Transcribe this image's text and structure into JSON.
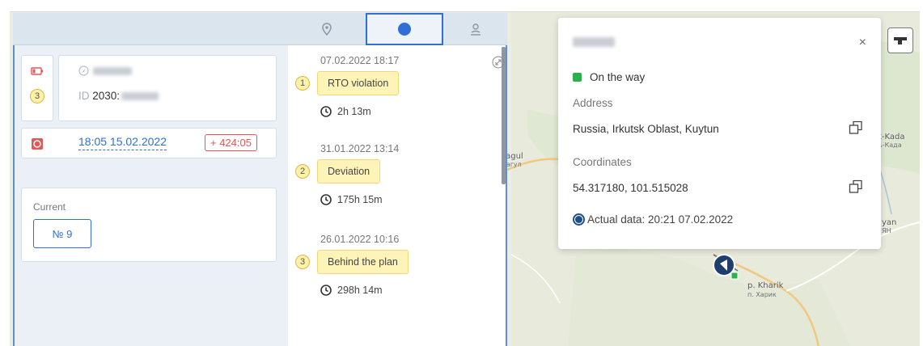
{
  "vehicle": {
    "badge_number": "3",
    "id_prefix": "ID",
    "id_value": "2030:"
  },
  "status_card": {
    "time": "18:05 15.02.2022",
    "delay": "+ 424:05"
  },
  "current": {
    "label": "Current",
    "number": "№ 9"
  },
  "timeline": [
    {
      "date": "07.02.2022 18:17",
      "num": "1",
      "tag": "RTO violation",
      "duration": "2h 13m"
    },
    {
      "date": "31.01.2022 13:14",
      "num": "2",
      "tag": "Deviation",
      "duration": "175h 15m"
    },
    {
      "date": "26.01.2022 10:16",
      "num": "3",
      "tag": "Behind the plan",
      "duration": "298h 14m"
    }
  ],
  "popup": {
    "close": "×",
    "status": "On the way",
    "address_label": "Address",
    "address": "Russia, Irkutsk Oblast, Kuytun",
    "coords_label": "Coordinates",
    "coords": "54.317180, 101.515028",
    "actual": "Actual data: 20:21 07.02.2022"
  },
  "map_labels": {
    "l1": "ragul",
    "l2": "Рагул",
    "l3": "t-Kada",
    "l4": "ь-Када",
    "l5": "yan",
    "l6": "ЯН",
    "l7": "p. Kharik",
    "l8": "п. Харик"
  },
  "colors": {
    "accent": "#2f6fd6",
    "status_green": "#2bb14a",
    "alert_red": "#e5555a",
    "tag_yellow": "#fff4b8"
  }
}
